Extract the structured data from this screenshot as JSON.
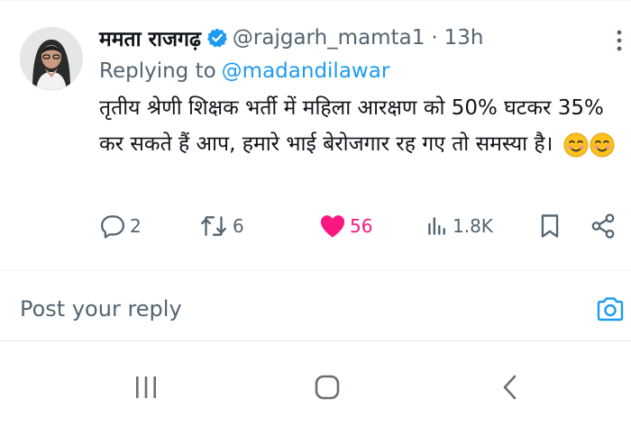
{
  "tweet": {
    "display_name": "ममता राजगढ़",
    "verified_icon": "verified-badge-icon",
    "handle": "@rajgarh_mamta1",
    "separator": "·",
    "time": "13h",
    "replying_prefix": "Replying to",
    "replying_handle": "@madandilawar",
    "text": "तृतीय श्रेणी शिक्षक भर्ती में महिला आरक्षण को 50% घटकर 35% कर सकते हैं आप, हमारे भाई बेरोजगार रह गए तो समस्या है।",
    "emojis": [
      "smiling-face-emoji",
      "smiling-face-emoji"
    ]
  },
  "actions": {
    "reply_count": "2",
    "retweet_count": "6",
    "like_count": "56",
    "views_count": "1.8K",
    "like_color": "#f91880",
    "accent_color": "#1d9bf0"
  },
  "reply_box": {
    "placeholder": "Post your reply"
  },
  "icons": {
    "more": "more-vertical-icon",
    "camera": "camera-icon",
    "reply": "reply-bubble-icon",
    "retweet": "retweet-icon",
    "like": "heart-icon",
    "views": "views-bar-icon",
    "bookmark": "bookmark-icon",
    "share": "share-icon",
    "nav_recents": "recents-icon",
    "nav_home": "home-icon",
    "nav_back": "back-icon"
  }
}
